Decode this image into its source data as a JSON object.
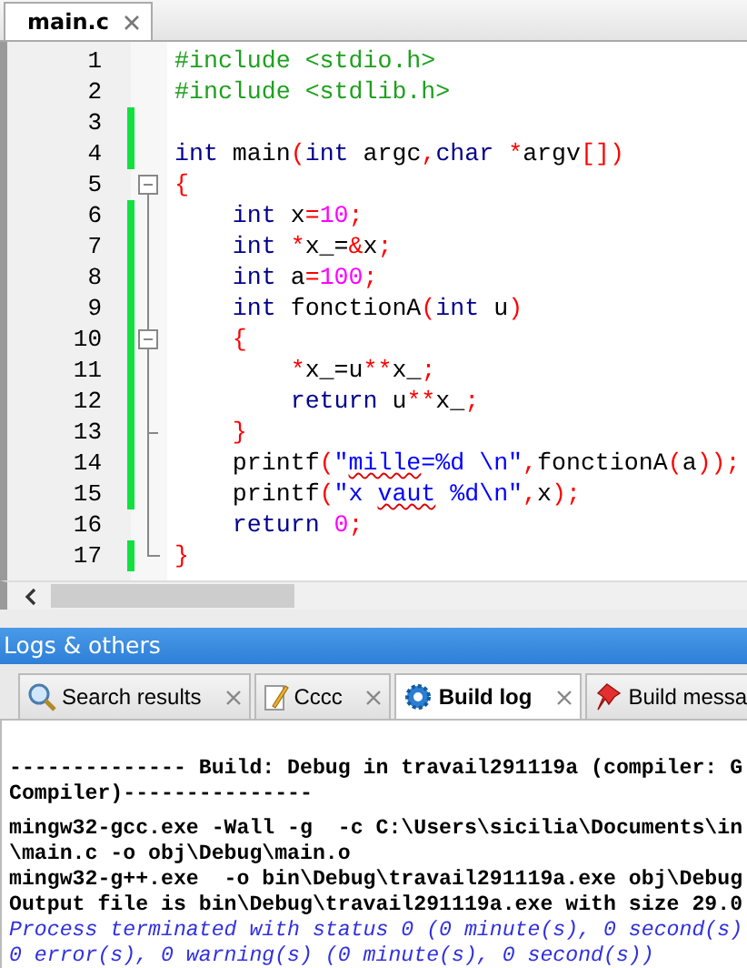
{
  "editor_tabs": [
    {
      "label": "main.c",
      "selected": true
    }
  ],
  "code_lines": [
    {
      "number": "1",
      "modified": false,
      "kind": "plain",
      "tokens": [
        {
          "kind": "preprocessor",
          "text": "#include <stdio.h>"
        }
      ]
    },
    {
      "number": "2",
      "modified": false,
      "kind": "plain",
      "tokens": [
        {
          "kind": "preprocessor",
          "text": "#include <stdlib.h>"
        }
      ]
    },
    {
      "number": "3",
      "modified": true,
      "kind": "plain"
    },
    {
      "number": "4",
      "modified": true,
      "kind": "plain",
      "tokens": [
        {
          "kind": "keyword",
          "text": "int"
        },
        {
          "kind": "identifier",
          "text": " main"
        },
        {
          "kind": "operator",
          "text": "("
        },
        {
          "kind": "keyword",
          "text": "int"
        },
        {
          "kind": "identifier",
          "text": " argc"
        },
        {
          "kind": "operator",
          "text": ","
        },
        {
          "kind": "keyword",
          "text": "char"
        },
        {
          "kind": "operator",
          "text": " *"
        },
        {
          "kind": "identifier",
          "text": "argv"
        },
        {
          "kind": "operator",
          "text": "[])"
        }
      ]
    },
    {
      "number": "5",
      "modified": false,
      "kind": "fold-start",
      "tokens": [
        {
          "kind": "operator",
          "text": "{"
        }
      ]
    },
    {
      "number": "6",
      "modified": true,
      "kind": "fold-body",
      "tokens": [
        {
          "kind": "keyword",
          "text": "    int"
        },
        {
          "kind": "identifier",
          "text": " x"
        },
        {
          "kind": "operator",
          "text": "="
        },
        {
          "kind": "number",
          "text": "10"
        },
        {
          "kind": "operator",
          "text": ";"
        }
      ]
    },
    {
      "number": "7",
      "modified": true,
      "kind": "fold-body",
      "tokens": [
        {
          "kind": "keyword",
          "text": "    int"
        },
        {
          "kind": "operator",
          "text": " *"
        },
        {
          "kind": "identifier",
          "text": "x_="
        },
        {
          "kind": "operator",
          "text": "&"
        },
        {
          "kind": "identifier",
          "text": "x"
        },
        {
          "kind": "operator",
          "text": ";"
        }
      ]
    },
    {
      "number": "8",
      "modified": true,
      "kind": "fold-body",
      "tokens": [
        {
          "kind": "keyword",
          "text": "    int"
        },
        {
          "kind": "identifier",
          "text": " a"
        },
        {
          "kind": "operator",
          "text": "="
        },
        {
          "kind": "number",
          "text": "100"
        },
        {
          "kind": "operator",
          "text": ";"
        }
      ]
    },
    {
      "number": "9",
      "modified": true,
      "kind": "fold-body",
      "tokens": [
        {
          "kind": "keyword",
          "text": "    int"
        },
        {
          "kind": "identifier",
          "text": " fonctionA"
        },
        {
          "kind": "operator",
          "text": "("
        },
        {
          "kind": "keyword",
          "text": "int"
        },
        {
          "kind": "identifier",
          "text": " u"
        },
        {
          "kind": "operator",
          "text": ")"
        }
      ]
    },
    {
      "number": "10",
      "modified": true,
      "kind": "fold-start",
      "tokens": [
        {
          "kind": "operator",
          "text": "    {"
        }
      ]
    },
    {
      "number": "11",
      "modified": true,
      "kind": "fold-body",
      "tokens": [
        {
          "kind": "operator",
          "text": "        *"
        },
        {
          "kind": "identifier",
          "text": "x_=u"
        },
        {
          "kind": "operator",
          "text": "**"
        },
        {
          "kind": "identifier",
          "text": "x_"
        },
        {
          "kind": "operator",
          "text": ";"
        }
      ]
    },
    {
      "number": "12",
      "modified": true,
      "kind": "fold-body",
      "tokens": [
        {
          "kind": "keyword",
          "text": "        return"
        },
        {
          "kind": "identifier",
          "text": " u"
        },
        {
          "kind": "operator",
          "text": "**"
        },
        {
          "kind": "identifier",
          "text": "x_"
        },
        {
          "kind": "operator",
          "text": ";"
        }
      ]
    },
    {
      "number": "13",
      "modified": true,
      "kind": "fold-close",
      "tokens": [
        {
          "kind": "operator",
          "text": "    }"
        }
      ]
    },
    {
      "number": "14",
      "modified": true,
      "kind": "fold-body",
      "tokens": [
        {
          "kind": "identifier",
          "text": "    printf"
        },
        {
          "kind": "operator",
          "text": "("
        },
        {
          "kind": "string",
          "text": "\""
        },
        {
          "kind": "string",
          "text": "mille",
          "misspelled": true
        },
        {
          "kind": "string",
          "text": "=%d \\n\""
        },
        {
          "kind": "operator",
          "text": ","
        },
        {
          "kind": "identifier",
          "text": "fonctionA"
        },
        {
          "kind": "operator",
          "text": "("
        },
        {
          "kind": "identifier",
          "text": "a"
        },
        {
          "kind": "operator",
          "text": "));"
        }
      ]
    },
    {
      "number": "15",
      "modified": true,
      "kind": "fold-body",
      "tokens": [
        {
          "kind": "identifier",
          "text": "    printf"
        },
        {
          "kind": "operator",
          "text": "("
        },
        {
          "kind": "string",
          "text": "\"x "
        },
        {
          "kind": "string",
          "text": "vaut",
          "misspelled": true
        },
        {
          "kind": "string",
          "text": " %d\\n\""
        },
        {
          "kind": "operator",
          "text": ","
        },
        {
          "kind": "identifier",
          "text": "x"
        },
        {
          "kind": "operator",
          "text": ");"
        }
      ]
    },
    {
      "number": "16",
      "modified": false,
      "kind": "fold-body",
      "tokens": [
        {
          "kind": "keyword",
          "text": "    return"
        },
        {
          "kind": "number",
          "text": " 0"
        },
        {
          "kind": "operator",
          "text": ";"
        }
      ]
    },
    {
      "number": "17",
      "modified": true,
      "kind": "fold-end",
      "tokens": [
        {
          "kind": "operator",
          "text": "}"
        }
      ]
    }
  ],
  "panel": {
    "title": "Logs & others",
    "tabs": [
      {
        "label": "Search results",
        "selected": false
      },
      {
        "label": "Cccc",
        "selected": false
      },
      {
        "label": "Build log",
        "selected": true
      },
      {
        "label": "Build messa",
        "selected": false
      }
    ],
    "log_lines": [
      {
        "kind": "header",
        "text": "-------------- Build: Debug in travail291119a (compiler: G"
      },
      {
        "kind": "header",
        "text": "Compiler)---------------"
      },
      {
        "kind": "command",
        "text": "mingw32-gcc.exe -Wall -g  -c C:\\Users\\sicilia\\Documents\\in"
      },
      {
        "kind": "command",
        "text": "\\main.c -o obj\\Debug\\main.o"
      },
      {
        "kind": "command",
        "text": "mingw32-g++.exe  -o bin\\Debug\\travail291119a.exe obj\\Debug"
      },
      {
        "kind": "command",
        "text": "Output file is bin\\Debug\\travail291119a.exe with size 29.0"
      },
      {
        "kind": "info",
        "text": "Process terminated with status 0 (0 minute(s), 0 second(s)"
      },
      {
        "kind": "info",
        "text": "0 error(s), 0 warning(s) (0 minute(s), 0 second(s))"
      }
    ]
  }
}
